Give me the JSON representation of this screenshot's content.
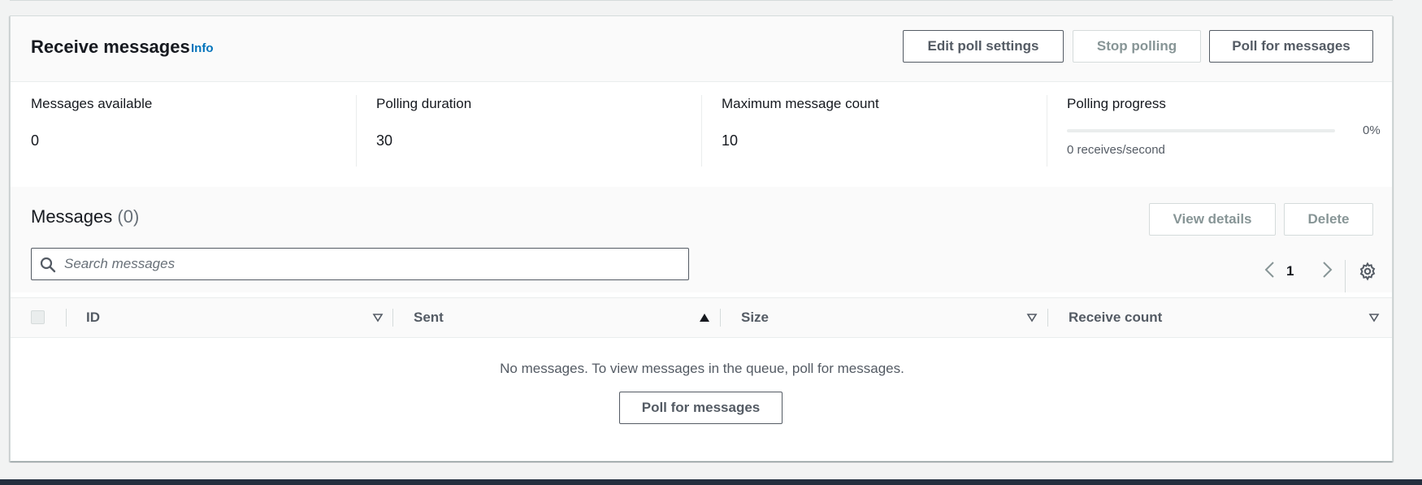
{
  "receive": {
    "title": "Receive messages",
    "info_link": "Info",
    "buttons": {
      "edit_poll_settings": "Edit poll settings",
      "stop_polling": "Stop polling",
      "poll_for_messages": "Poll for messages"
    }
  },
  "stats": {
    "messages_available": {
      "label": "Messages available",
      "value": "0"
    },
    "polling_duration": {
      "label": "Polling duration",
      "value": "30"
    },
    "max_message_count": {
      "label": "Maximum message count",
      "value": "10"
    },
    "polling_progress": {
      "label": "Polling progress",
      "percent_text": "0%",
      "percent": 0,
      "rate": "0 receives/second"
    }
  },
  "messages": {
    "title": "Messages",
    "count": "(0)",
    "view_details": "View details",
    "delete": "Delete",
    "search_placeholder": "Search messages",
    "page": "1",
    "columns": [
      "ID",
      "Sent",
      "Size",
      "Receive count"
    ],
    "sorted_column": "Sent",
    "sort_direction": "ascending",
    "empty_text": "No messages. To view messages in the queue, poll for messages.",
    "empty_button": "Poll for messages"
  },
  "colors": {
    "accent": "#0073bb",
    "border": "#545b64",
    "disabled": "#879596",
    "footer": "#232f3e"
  },
  "icons": {
    "search": "search-icon",
    "prev": "chevron-left-icon",
    "next": "chevron-right-icon",
    "settings": "gear-icon",
    "sort_asc": "caret-up-filled-icon",
    "sort_none": "caret-down-outline-icon"
  }
}
